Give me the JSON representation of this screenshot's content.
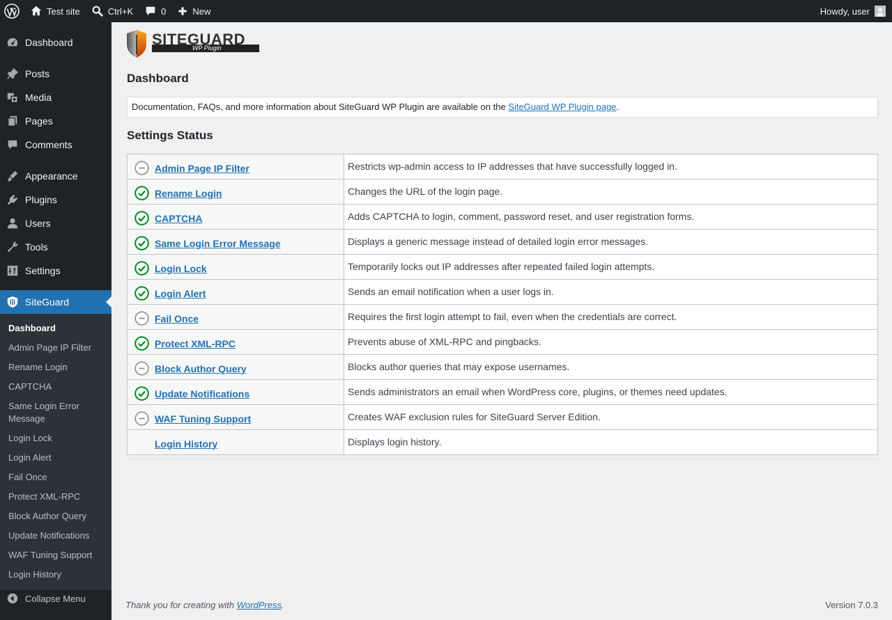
{
  "admin_bar": {
    "site_name": "Test site",
    "search_shortcut": "Ctrl+K",
    "comments_count": "0",
    "new_label": "New",
    "greeting": "Howdy, user"
  },
  "sidebar": {
    "items": [
      {
        "label": "Dashboard",
        "icon": "dashboard-icon"
      },
      {
        "label": "Posts",
        "icon": "pin-icon"
      },
      {
        "label": "Media",
        "icon": "media-icon"
      },
      {
        "label": "Pages",
        "icon": "pages-icon"
      },
      {
        "label": "Comments",
        "icon": "comment-icon"
      },
      {
        "label": "Appearance",
        "icon": "brush-icon"
      },
      {
        "label": "Plugins",
        "icon": "plugin-icon"
      },
      {
        "label": "Users",
        "icon": "user-icon"
      },
      {
        "label": "Tools",
        "icon": "wrench-icon"
      },
      {
        "label": "Settings",
        "icon": "settings-icon"
      },
      {
        "label": "SiteGuard",
        "icon": "siteguard-icon"
      }
    ],
    "submenu": [
      "Dashboard",
      "Admin Page IP Filter",
      "Rename Login",
      "CAPTCHA",
      "Same Login Error Message",
      "Login Lock",
      "Login Alert",
      "Fail Once",
      "Protect XML-RPC",
      "Block Author Query",
      "Update Notifications",
      "WAF Tuning Support",
      "Login History"
    ],
    "collapse_label": "Collapse Menu"
  },
  "main": {
    "logo_text": "SITEGUARD",
    "logo_sub": "WP Plugin",
    "title": "Dashboard",
    "notice_text": "Documentation, FAQs, and more information about SiteGuard WP Plugin are available on the ",
    "notice_link": "SiteGuard WP Plugin page",
    "notice_end": ".",
    "section_title": "Settings Status",
    "rows": [
      {
        "name": "Admin Page IP Filter",
        "status": "off",
        "desc": "Restricts wp-admin access to IP addresses that have successfully logged in."
      },
      {
        "name": "Rename Login",
        "status": "on",
        "desc": "Changes the URL of the login page."
      },
      {
        "name": "CAPTCHA",
        "status": "on",
        "desc": "Adds CAPTCHA to login, comment, password reset, and user registration forms."
      },
      {
        "name": "Same Login Error Message",
        "status": "on",
        "desc": "Displays a generic message instead of detailed login error messages."
      },
      {
        "name": "Login Lock",
        "status": "on",
        "desc": "Temporarily locks out IP addresses after repeated failed login attempts."
      },
      {
        "name": "Login Alert",
        "status": "on",
        "desc": "Sends an email notification when a user logs in."
      },
      {
        "name": "Fail Once",
        "status": "off",
        "desc": "Requires the first login attempt to fail, even when the credentials are correct."
      },
      {
        "name": "Protect XML-RPC",
        "status": "on",
        "desc": "Prevents abuse of XML-RPC and pingbacks."
      },
      {
        "name": "Block Author Query",
        "status": "off",
        "desc": "Blocks author queries that may expose usernames."
      },
      {
        "name": "Update Notifications",
        "status": "on",
        "desc": "Sends administrators an email when WordPress core, plugins, or themes need updates."
      },
      {
        "name": "WAF Tuning Support",
        "status": "off",
        "desc": "Creates WAF exclusion rules for SiteGuard Server Edition."
      },
      {
        "name": "Login History",
        "status": "none",
        "desc": "Displays login history."
      }
    ]
  },
  "footer": {
    "thanks_text": "Thank you for creating with ",
    "thanks_link": "WordPress",
    "thanks_end": ".",
    "version": "Version 7.0.3"
  },
  "colors": {
    "accent": "#2271b1",
    "status_on": "#008a20",
    "status_off": "#8c8f94"
  }
}
